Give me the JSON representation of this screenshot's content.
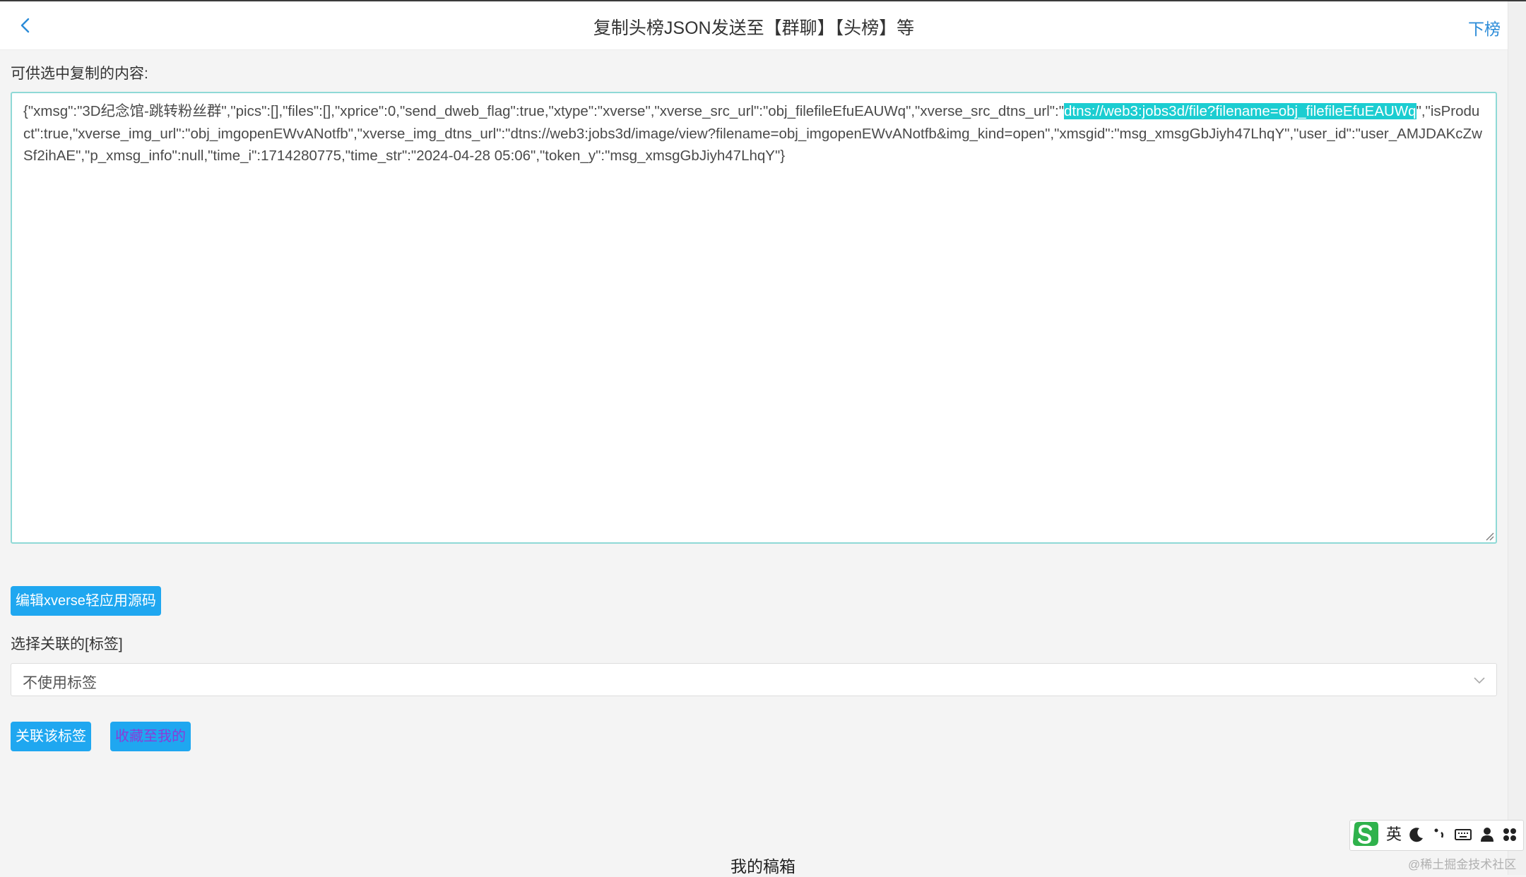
{
  "header": {
    "title": "复制头榜JSON发送至【群聊】【头榜】等",
    "right_label": "下榜"
  },
  "content": {
    "section_label": "可供选中复制的内容:",
    "json_before": "{\"xmsg\":\"3D纪念馆-跳转粉丝群\",\"pics\":[],\"files\":[],\"xprice\":0,\"send_dweb_flag\":true,\"xtype\":\"xverse\",\"xverse_src_url\":\"obj_filefileEfuEAUWq\",\"xverse_src_dtns_url\":\"",
    "json_selected": "dtns://web3:jobs3d/file?filename=obj_filefileEfuEAUWq",
    "json_after": "\",\"isProduct\":true,\"xverse_img_url\":\"obj_imgopenEWvANotfb\",\"xverse_img_dtns_url\":\"dtns://web3:jobs3d/image/view?filename=obj_imgopenEWvANotfb&img_kind=open\",\"xmsgid\":\"msg_xmsgGbJiyh47LhqY\",\"user_id\":\"user_AMJDAKcZwSf2ihAE\",\"p_xmsg_info\":null,\"time_i\":1714280775,\"time_str\":\"2024-04-28 05:06\",\"token_y\":\"msg_xmsgGbJiyh47LhqY\"}"
  },
  "buttons": {
    "edit_source": "编辑xverse轻应用源码",
    "link_tag": "关联该标签",
    "favorite": "收藏至我的"
  },
  "tag": {
    "label": "选择关联的[标签]",
    "selected": "不使用标签"
  },
  "footer": {
    "title": "我的稿箱"
  },
  "ime": {
    "lang": "英"
  },
  "watermark": "@稀土掘金技术社区",
  "colors": {
    "accent": "#1fa7f0",
    "selection": "#1ccdd1",
    "link": "#2a8bd8",
    "favorite_text": "#8a3cd8"
  }
}
